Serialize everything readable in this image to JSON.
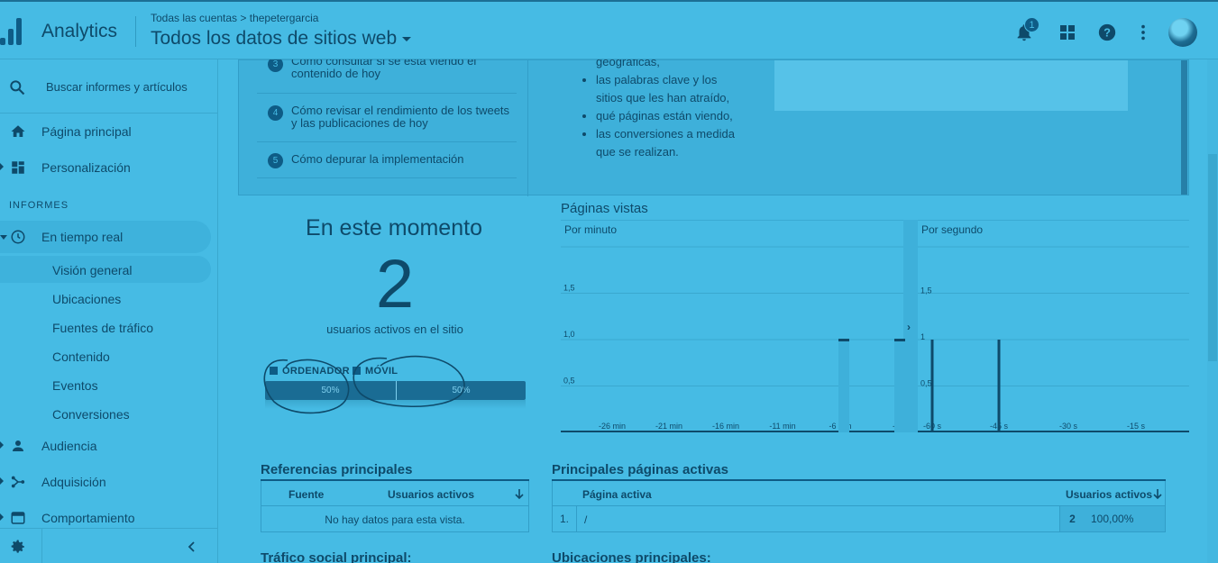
{
  "header": {
    "app_name": "Analytics",
    "breadcrumb": "Todas las cuentas > thepetergarcia",
    "view_name": "Todos los datos de sitios web",
    "notifications_count": "1"
  },
  "sidebar": {
    "search_label": "Buscar informes y artículos",
    "home": "Página principal",
    "customization": "Personalización",
    "reports_header": "INFORMES",
    "realtime": "En tiempo real",
    "realtime_items": [
      "Visión general",
      "Ubicaciones",
      "Fuentes de tráfico",
      "Contenido",
      "Eventos",
      "Conversiones"
    ],
    "audience": "Audiencia",
    "acquisition": "Adquisición",
    "behavior": "Comportamiento"
  },
  "tips": {
    "items": [
      {
        "num": "3",
        "text": "Cómo consultar si se está viendo el contenido de hoy"
      },
      {
        "num": "4",
        "text": "Cómo revisar el rendimiento de los tweets y las publicaciones de hoy"
      },
      {
        "num": "5",
        "text": "Cómo depurar la implementación"
      }
    ],
    "bullets_partial_top": "geográficas,",
    "bullets": [
      "las palabras clave y los sitios que les han atraído,",
      "qué páginas están viendo,",
      "las conversiones a medida que se realizan."
    ]
  },
  "now": {
    "title": "En este momento",
    "count": "2",
    "subtitle": "usuarios activos en el sitio",
    "legend_desktop": "ORDENADOR",
    "legend_mobile": "MÓVIL",
    "desktop_pct": "50%",
    "mobile_pct": "50%",
    "desktop_share": 0.5,
    "mobile_share": 0.5
  },
  "pageviews": {
    "title": "Páginas vistas",
    "per_minute_label": "Por minuto",
    "per_second_label": "Por segundo",
    "arrow": "›"
  },
  "chart_data": [
    {
      "type": "bar",
      "title": "Por minuto",
      "categories": [
        "-26 min",
        "-21 min",
        "-16 min",
        "-11 min",
        "-6 min",
        "-1"
      ],
      "y_ticks": [
        "0,5",
        "1,0",
        "1,5"
      ],
      "ylim": [
        0,
        2
      ],
      "bars": [
        {
          "x": "-6 min",
          "value": 1
        },
        {
          "x": "-1",
          "value": 1
        }
      ]
    },
    {
      "type": "bar",
      "title": "Por segundo",
      "categories": [
        "-60 s",
        "-45 s",
        "-30 s",
        "-15 s"
      ],
      "y_ticks": [
        "0,5",
        "1",
        "1,5"
      ],
      "ylim": [
        0,
        2
      ],
      "bars": [
        {
          "x": "-60 s",
          "value": 1
        },
        {
          "x": "-45 s",
          "value": 1
        }
      ]
    }
  ],
  "referrals": {
    "title": "Referencias principales",
    "col_source": "Fuente",
    "col_users": "Usuarios activos",
    "empty": "No hay datos para esta vista."
  },
  "top_pages": {
    "title": "Principales páginas activas",
    "col_page": "Página activa",
    "col_users": "Usuarios activos",
    "rows": [
      {
        "idx": "1.",
        "page": "/",
        "users": "2",
        "pct": "100,00%"
      }
    ]
  },
  "social": {
    "title": "Tráfico social principal:"
  },
  "locations": {
    "title": "Ubicaciones principales:"
  }
}
